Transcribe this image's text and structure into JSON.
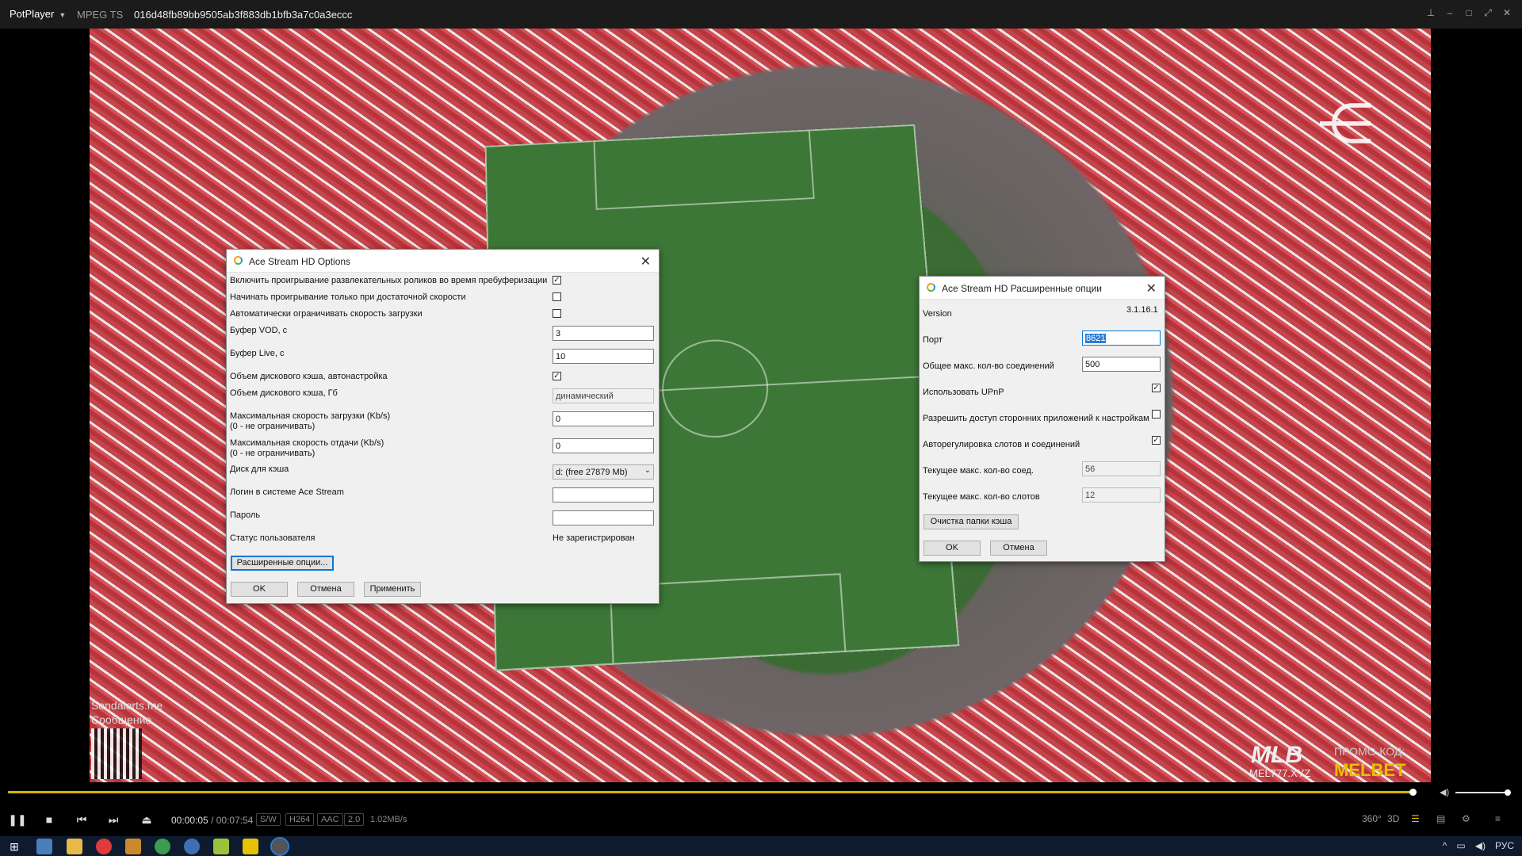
{
  "titlebar": {
    "app": "PotPlayer",
    "format": "MPEG TS",
    "filename": "016d48fb89bb9505ab3f883db1bfb3a7c0a3eccc"
  },
  "video_overlay": {
    "sendalerts": "Sendalerts.me",
    "message": "Сообщение",
    "mlb": "MLB",
    "mlb_url": "MEL777.XYZ",
    "promo_label": "ПРОМО-КОД:",
    "promo_code": "MELBET"
  },
  "player": {
    "time_current": "00:00:05",
    "time_total": "00:07:54",
    "tags": [
      "S/W",
      "H264",
      "AAC",
      "2.0"
    ],
    "rate": "1.02MB/s",
    "right_icons": [
      "360°",
      "3D"
    ]
  },
  "options_dialog": {
    "title": "Ace Stream HD Options",
    "rows": {
      "enable_ads": "Включить проигрывание развлекательных роликов во время пребуферизации",
      "start_speed": "Начинать проигрывание только при достаточной скорости",
      "auto_limit": "Автоматически ограничивать скорость загрузки",
      "vod_buffer": "Буфер VOD, с",
      "live_buffer": "Буфер Live, с",
      "disk_cache_auto": "Объем дискового кэша, автонастройка",
      "disk_cache_gb": "Объем дискового кэша, Гб",
      "max_download": "Максимальная скорость загрузки (Kb/s)",
      "max_download_hint": "(0 - не ограничивать)",
      "max_upload": "Максимальная скорость отдачи (Kb/s)",
      "max_upload_hint": "(0 - не ограничивать)",
      "cache_disk": "Диск для кэша",
      "login": "Логин в системе Ace Stream",
      "password": "Пароль",
      "user_status": "Статус пользователя"
    },
    "values": {
      "vod_buffer": "3",
      "live_buffer": "10",
      "disk_cache_gb": "динамический",
      "max_download": "0",
      "max_upload": "0",
      "cache_disk": "d:  (free 27879 Mb)",
      "login": "",
      "password": "",
      "user_status": "Не зарегистрирован"
    },
    "checks": {
      "enable_ads": true,
      "start_speed": false,
      "auto_limit": false,
      "disk_cache_auto": true
    },
    "buttons": {
      "advanced": "Расширенные опции...",
      "ok": "OK",
      "cancel": "Отмена",
      "apply": "Применить"
    }
  },
  "advanced_dialog": {
    "title": "Ace Stream HD Расширенные опции",
    "rows": {
      "version": "Version",
      "port": "Порт",
      "total_conn": "Общее макс. кол-во соединений",
      "upnp": "Использовать UPnP",
      "third_party": "Разрешить доступ сторонних приложений к настройкам",
      "auto_slots": "Авторегулировка слотов и соединений",
      "cur_conn": "Текущее макс. кол-во соед.",
      "cur_slots": "Текущее макс. кол-во слотов"
    },
    "values": {
      "version": "3.1.16.1",
      "port": "8621",
      "total_conn": "500",
      "cur_conn": "56",
      "cur_slots": "12"
    },
    "checks": {
      "upnp": true,
      "third_party": false,
      "auto_slots": true
    },
    "buttons": {
      "clear_cache": "Очистка папки кэша",
      "ok": "OK",
      "cancel": "Отмена"
    }
  },
  "taskbar": {
    "lang": "РУС"
  }
}
